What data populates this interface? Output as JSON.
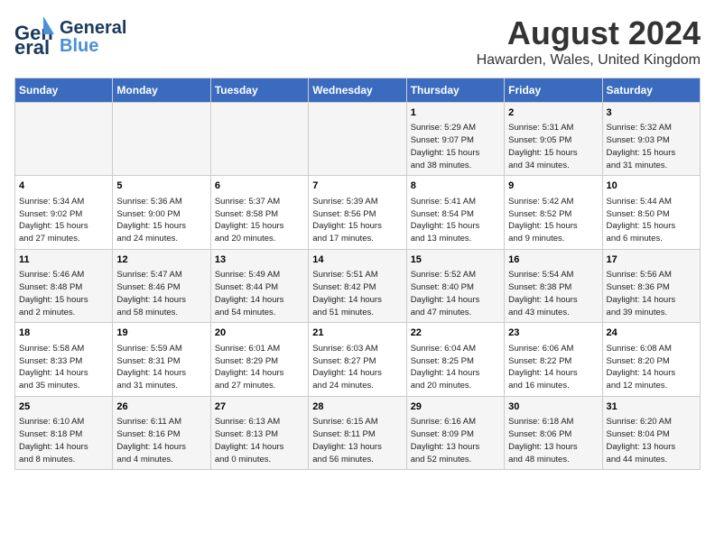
{
  "logo": {
    "part1": "General",
    "part2": "Blue"
  },
  "title": "August 2024",
  "location": "Hawarden, Wales, United Kingdom",
  "days_of_week": [
    "Sunday",
    "Monday",
    "Tuesday",
    "Wednesday",
    "Thursday",
    "Friday",
    "Saturday"
  ],
  "weeks": [
    [
      {
        "day": "",
        "info": ""
      },
      {
        "day": "",
        "info": ""
      },
      {
        "day": "",
        "info": ""
      },
      {
        "day": "",
        "info": ""
      },
      {
        "day": "1",
        "info": "Sunrise: 5:29 AM\nSunset: 9:07 PM\nDaylight: 15 hours\nand 38 minutes."
      },
      {
        "day": "2",
        "info": "Sunrise: 5:31 AM\nSunset: 9:05 PM\nDaylight: 15 hours\nand 34 minutes."
      },
      {
        "day": "3",
        "info": "Sunrise: 5:32 AM\nSunset: 9:03 PM\nDaylight: 15 hours\nand 31 minutes."
      }
    ],
    [
      {
        "day": "4",
        "info": "Sunrise: 5:34 AM\nSunset: 9:02 PM\nDaylight: 15 hours\nand 27 minutes."
      },
      {
        "day": "5",
        "info": "Sunrise: 5:36 AM\nSunset: 9:00 PM\nDaylight: 15 hours\nand 24 minutes."
      },
      {
        "day": "6",
        "info": "Sunrise: 5:37 AM\nSunset: 8:58 PM\nDaylight: 15 hours\nand 20 minutes."
      },
      {
        "day": "7",
        "info": "Sunrise: 5:39 AM\nSunset: 8:56 PM\nDaylight: 15 hours\nand 17 minutes."
      },
      {
        "day": "8",
        "info": "Sunrise: 5:41 AM\nSunset: 8:54 PM\nDaylight: 15 hours\nand 13 minutes."
      },
      {
        "day": "9",
        "info": "Sunrise: 5:42 AM\nSunset: 8:52 PM\nDaylight: 15 hours\nand 9 minutes."
      },
      {
        "day": "10",
        "info": "Sunrise: 5:44 AM\nSunset: 8:50 PM\nDaylight: 15 hours\nand 6 minutes."
      }
    ],
    [
      {
        "day": "11",
        "info": "Sunrise: 5:46 AM\nSunset: 8:48 PM\nDaylight: 15 hours\nand 2 minutes."
      },
      {
        "day": "12",
        "info": "Sunrise: 5:47 AM\nSunset: 8:46 PM\nDaylight: 14 hours\nand 58 minutes."
      },
      {
        "day": "13",
        "info": "Sunrise: 5:49 AM\nSunset: 8:44 PM\nDaylight: 14 hours\nand 54 minutes."
      },
      {
        "day": "14",
        "info": "Sunrise: 5:51 AM\nSunset: 8:42 PM\nDaylight: 14 hours\nand 51 minutes."
      },
      {
        "day": "15",
        "info": "Sunrise: 5:52 AM\nSunset: 8:40 PM\nDaylight: 14 hours\nand 47 minutes."
      },
      {
        "day": "16",
        "info": "Sunrise: 5:54 AM\nSunset: 8:38 PM\nDaylight: 14 hours\nand 43 minutes."
      },
      {
        "day": "17",
        "info": "Sunrise: 5:56 AM\nSunset: 8:36 PM\nDaylight: 14 hours\nand 39 minutes."
      }
    ],
    [
      {
        "day": "18",
        "info": "Sunrise: 5:58 AM\nSunset: 8:33 PM\nDaylight: 14 hours\nand 35 minutes."
      },
      {
        "day": "19",
        "info": "Sunrise: 5:59 AM\nSunset: 8:31 PM\nDaylight: 14 hours\nand 31 minutes."
      },
      {
        "day": "20",
        "info": "Sunrise: 6:01 AM\nSunset: 8:29 PM\nDaylight: 14 hours\nand 27 minutes."
      },
      {
        "day": "21",
        "info": "Sunrise: 6:03 AM\nSunset: 8:27 PM\nDaylight: 14 hours\nand 24 minutes."
      },
      {
        "day": "22",
        "info": "Sunrise: 6:04 AM\nSunset: 8:25 PM\nDaylight: 14 hours\nand 20 minutes."
      },
      {
        "day": "23",
        "info": "Sunrise: 6:06 AM\nSunset: 8:22 PM\nDaylight: 14 hours\nand 16 minutes."
      },
      {
        "day": "24",
        "info": "Sunrise: 6:08 AM\nSunset: 8:20 PM\nDaylight: 14 hours\nand 12 minutes."
      }
    ],
    [
      {
        "day": "25",
        "info": "Sunrise: 6:10 AM\nSunset: 8:18 PM\nDaylight: 14 hours\nand 8 minutes."
      },
      {
        "day": "26",
        "info": "Sunrise: 6:11 AM\nSunset: 8:16 PM\nDaylight: 14 hours\nand 4 minutes."
      },
      {
        "day": "27",
        "info": "Sunrise: 6:13 AM\nSunset: 8:13 PM\nDaylight: 14 hours\nand 0 minutes."
      },
      {
        "day": "28",
        "info": "Sunrise: 6:15 AM\nSunset: 8:11 PM\nDaylight: 13 hours\nand 56 minutes."
      },
      {
        "day": "29",
        "info": "Sunrise: 6:16 AM\nSunset: 8:09 PM\nDaylight: 13 hours\nand 52 minutes."
      },
      {
        "day": "30",
        "info": "Sunrise: 6:18 AM\nSunset: 8:06 PM\nDaylight: 13 hours\nand 48 minutes."
      },
      {
        "day": "31",
        "info": "Sunrise: 6:20 AM\nSunset: 8:04 PM\nDaylight: 13 hours\nand 44 minutes."
      }
    ]
  ]
}
